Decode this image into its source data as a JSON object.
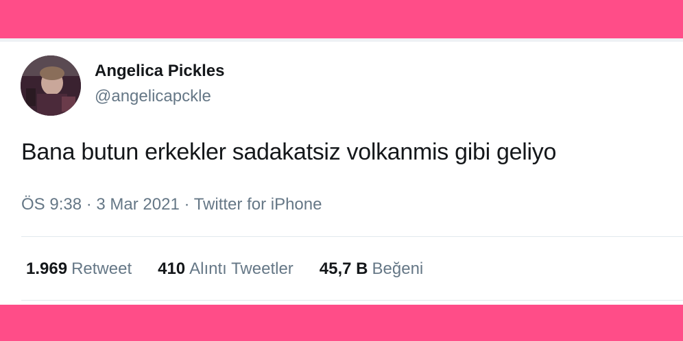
{
  "colors": {
    "frame": "#ff4d88",
    "card": "#ffffff",
    "text_primary": "#14171a",
    "text_secondary": "#657786"
  },
  "author": {
    "display_name": "Angelica Pickles",
    "handle": "@angelicapckle",
    "avatar_icon": "user-avatar-photo"
  },
  "tweet": {
    "text": "Bana butun erkekler sadakatsiz volkanmis gibi geliyo",
    "time": "ÖS 9:38",
    "separator": "·",
    "date": "3 Mar 2021",
    "source": "Twitter for iPhone"
  },
  "stats": {
    "retweets": {
      "count": "1.969",
      "label": "Retweet"
    },
    "quotes": {
      "count": "410",
      "label": "Alıntı Tweetler"
    },
    "likes": {
      "count": "45,7 B",
      "label": "Beğeni"
    }
  }
}
